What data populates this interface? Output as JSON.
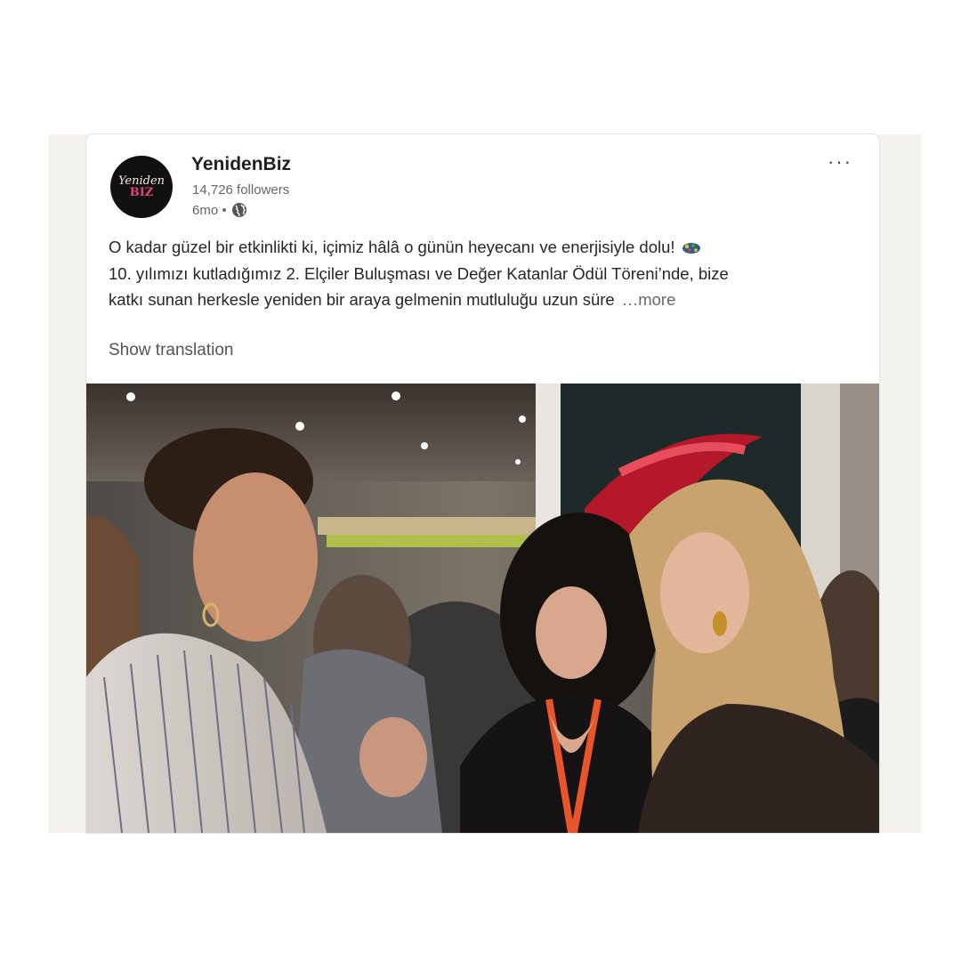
{
  "post": {
    "author_name": "YenidenBiz",
    "avatar_line1": "Yeniden",
    "avatar_line2": "BIZ",
    "followers": "14,726 followers",
    "time": "6mo •",
    "menu_label": "···",
    "text_lines": [
      "O kadar güzel bir etkinlikti ki, içimiz hâlâ o günün heyecanı ve enerjisiyle dolu!",
      "10. yılımızı kutladığımız 2. Elçiler Buluşması ve Değer Katanlar Ödül Töreni’nde, bize",
      "katkı sunan herkesle yeniden bir araya gelmenin mutluluğu uzun süre"
    ],
    "more_label": "…more",
    "show_translation": "Show translation"
  },
  "icons": {
    "globe": "globe-icon",
    "menu": "more-options-icon",
    "emoji": "confetti-emoji-icon"
  },
  "colors": {
    "background_panel": "#f4f2ee",
    "card": "#ffffff",
    "avatar_bg": "#111111",
    "avatar_accent": "#e3417f",
    "text_primary": "#262626",
    "text_secondary": "#666666",
    "lanyard": "#e8552a"
  }
}
